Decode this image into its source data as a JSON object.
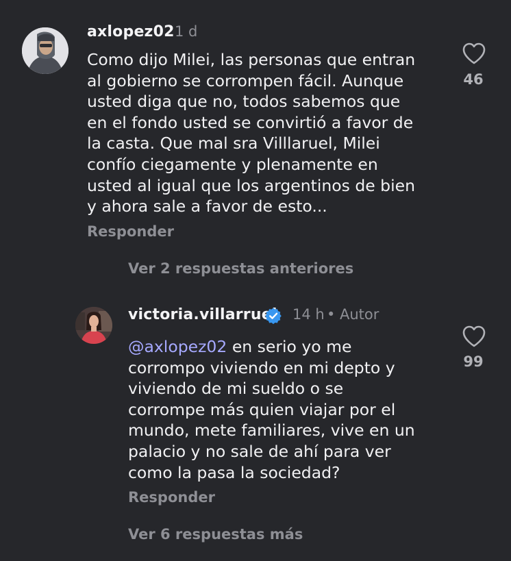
{
  "comment1": {
    "username": "axlopez02",
    "time": "1 d",
    "text": "Como dijo Milei, las personas que entran\nal gobierno se corrompen fácil. Aunque\nusted diga que no, todos sabemos que\nen el fondo usted se convirtió a favor de\nla casta. Que mal sra Villlaruel, Milei\nconfío ciegamente y plenamente en\nusted al igual que los argentinos de bien\ny ahora sale a favor de esto...",
    "reply_label": "Responder",
    "likes": "46"
  },
  "view_previous_replies": "Ver 2 respuestas anteriores",
  "reply1": {
    "username": "victoria.villarruel",
    "time": "14 h",
    "separator": "•",
    "author_badge": "Autor",
    "mention": "@axlopez02",
    "text": "en serio yo me\ncorrompo viviendo en mi depto y\nviviendo de mi sueldo o se\ncorrompe más quien viajar por el\nmundo, mete familiares, vive en un\npalacio y no sale de ahí para ver\ncomo la pasa la sociedad?",
    "reply_label": "Responder",
    "likes": "99"
  },
  "view_more_replies": "Ver 6 respuestas más",
  "colors": {
    "background": "#26272b",
    "text": "#f1f1f3",
    "muted": "#8e8f95",
    "mention": "#a6a9ff",
    "verified": "#3897f0"
  },
  "icons": {
    "like": "heart-outline-icon",
    "verified": "verified-badge-icon"
  }
}
